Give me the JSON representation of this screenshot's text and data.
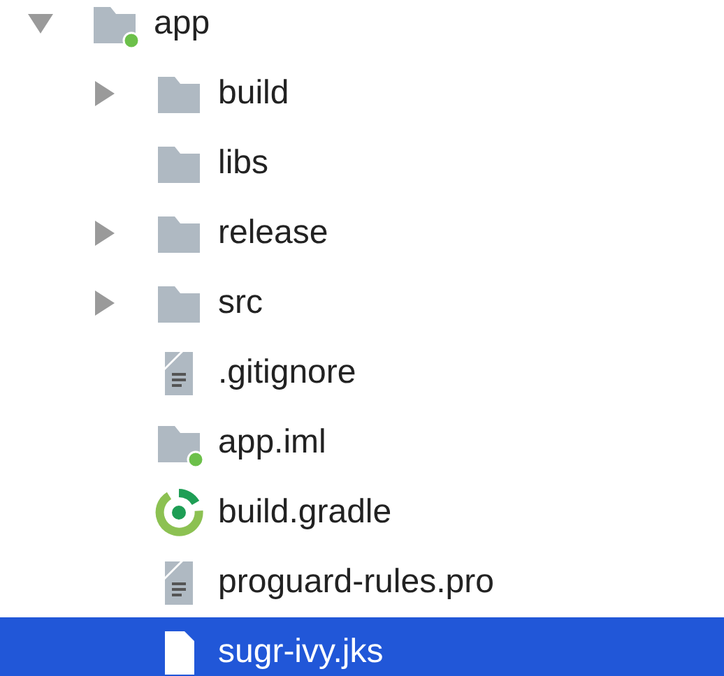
{
  "tree": [
    {
      "label": "app",
      "kind": "module",
      "expanded": true,
      "selected": false,
      "children": [
        {
          "label": "build",
          "kind": "folder",
          "expanded": false,
          "selected": false
        },
        {
          "label": "libs",
          "kind": "folder",
          "selected": false
        },
        {
          "label": "release",
          "kind": "folder",
          "expanded": false,
          "selected": false
        },
        {
          "label": "src",
          "kind": "folder",
          "expanded": false,
          "selected": false
        },
        {
          "label": ".gitignore",
          "kind": "text",
          "selected": false
        },
        {
          "label": "app.iml",
          "kind": "module",
          "selected": false
        },
        {
          "label": "build.gradle",
          "kind": "gradle",
          "selected": false
        },
        {
          "label": "proguard-rules.pro",
          "kind": "text",
          "selected": false
        },
        {
          "label": "sugr-ivy.jks",
          "kind": "file",
          "selected": true
        }
      ]
    }
  ]
}
